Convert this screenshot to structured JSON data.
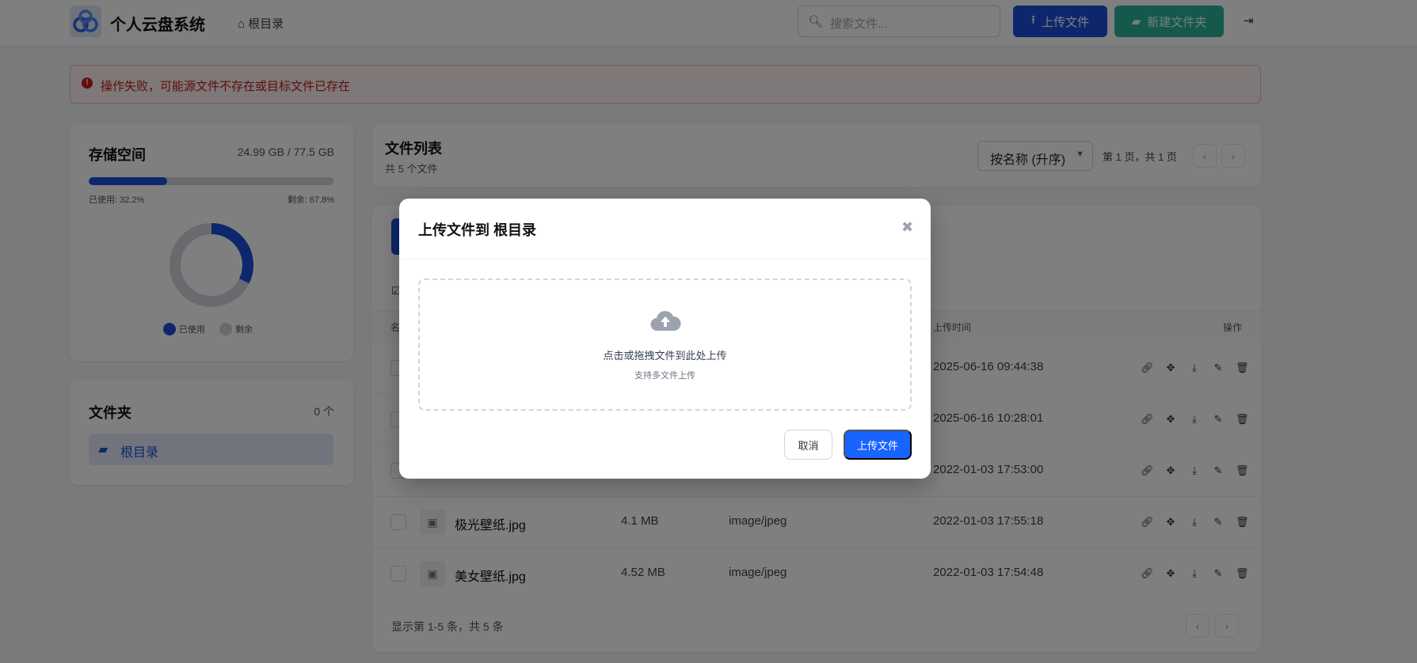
{
  "header": {
    "app_title": "个人云盘系统",
    "breadcrumb": "根目录",
    "search_placeholder": "搜索文件...",
    "upload_label": "上传文件",
    "new_folder_label": "新建文件夹"
  },
  "alert": {
    "message": "操作失败，可能源文件不存在或目标文件已存在",
    "color": "#b91c1c"
  },
  "storage": {
    "title": "存储空间",
    "usage": "24.99 GB / 77.5 GB",
    "used_percent": 32.2,
    "used_label": "已使用: 32.2%",
    "free_label": "剩余: 67.8%",
    "legend_used": "已使用",
    "legend_free": "剩余",
    "used_color": "#1d4ed8",
    "free_color": "#d1d5db"
  },
  "folders": {
    "title": "文件夹",
    "count": "0 个",
    "items": [
      {
        "label": "根目录"
      }
    ]
  },
  "file_list": {
    "title": "文件列表",
    "subtitle": "共 5 个文件",
    "sort": "按名称 (升序)",
    "page_info": "第 1 页，共 1 页"
  },
  "table": {
    "col_name_partial": "名",
    "col_time": "上传时间",
    "col_actions": "操作",
    "rows": [
      {
        "name": "",
        "size": "",
        "type": "",
        "time": "2025-06-16 09:44:38"
      },
      {
        "name": "",
        "size": "",
        "type": "",
        "time": "2025-06-16 10:28:01"
      },
      {
        "name": "",
        "size": "",
        "type": "",
        "time": "2022-01-03 17:53:00"
      },
      {
        "name": "极光壁纸.jpg",
        "size": "4.1 MB",
        "type": "image/jpeg",
        "time": "2022-01-03 17:55:18"
      },
      {
        "name": "美女壁纸.jpg",
        "size": "4.52 MB",
        "type": "image/jpeg",
        "time": "2022-01-03 17:54:48"
      }
    ],
    "footer": "显示第 1-5 条，共 5 条"
  },
  "modal": {
    "title": "上传文件到 根目录",
    "drop_text": "点击或拖拽文件到此处上传",
    "drop_hint": "支持多文件上传",
    "cancel": "取消",
    "upload": "上传文件",
    "accent": "#1764ff"
  }
}
